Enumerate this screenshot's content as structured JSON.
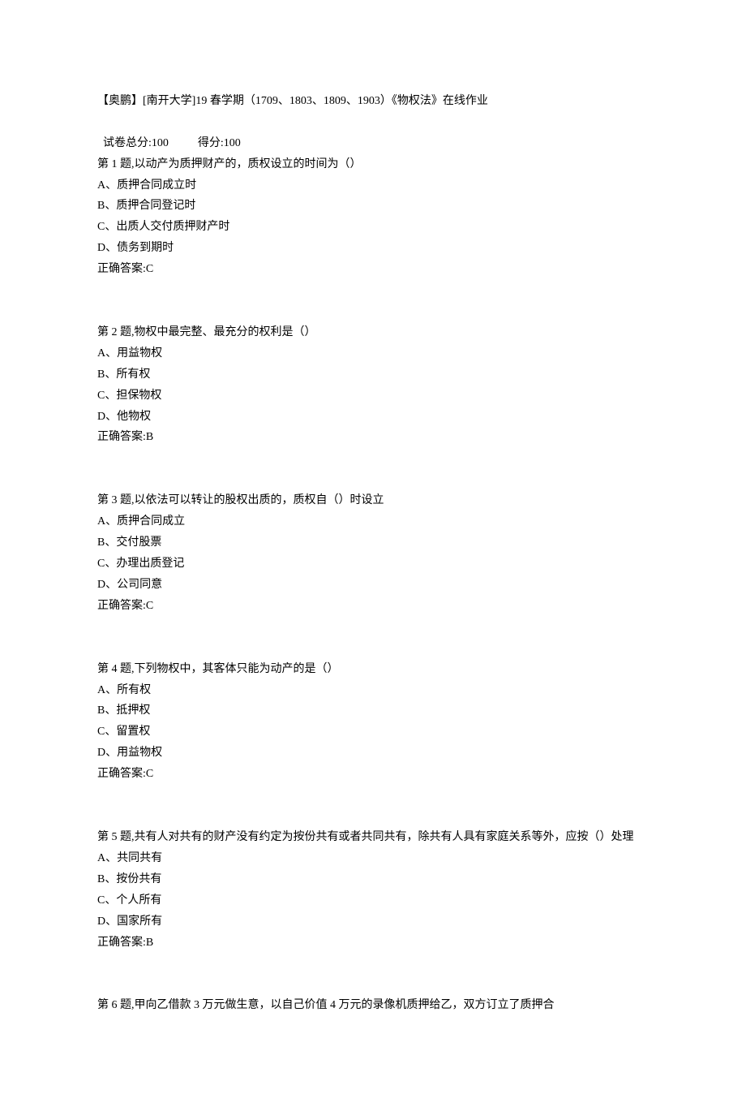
{
  "header": {
    "title": "【奥鹏】[南开大学]19 春学期（1709、1803、1809、1903）《物权法》在线作业",
    "score_total_label": "试卷总分:100",
    "score_obtained_label": "得分:100"
  },
  "questions": [
    {
      "stem": "第 1 题,以动产为质押财产的，质权设立的时间为（）",
      "options": [
        "A、质押合同成立时",
        "B、质押合同登记时",
        "C、出质人交付质押财产时",
        "D、债务到期时"
      ],
      "answer": "正确答案:C"
    },
    {
      "stem": "第 2 题,物权中最完整、最充分的权利是（）",
      "options": [
        "A、用益物权",
        "B、所有权",
        "C、担保物权",
        "D、他物权"
      ],
      "answer": "正确答案:B"
    },
    {
      "stem": "第 3 题,以依法可以转让的股权出质的，质权自（）时设立",
      "options": [
        "A、质押合同成立",
        "B、交付股票",
        "C、办理出质登记",
        "D、公司同意"
      ],
      "answer": "正确答案:C"
    },
    {
      "stem": "第 4 题,下列物权中，其客体只能为动产的是（）",
      "options": [
        "A、所有权",
        "B、抵押权",
        "C、留置权",
        "D、用益物权"
      ],
      "answer": "正确答案:C"
    },
    {
      "stem": "第 5 题,共有人对共有的财产没有约定为按份共有或者共同共有，除共有人具有家庭关系等外，应按（）处理",
      "options": [
        "A、共同共有",
        "B、按份共有",
        "C、个人所有",
        "D、国家所有"
      ],
      "answer": "正确答案:B"
    },
    {
      "stem": "第 6 题,甲向乙借款 3 万元做生意，以自己价值 4 万元的录像机质押给乙，双方订立了质押合",
      "options": [],
      "answer": ""
    }
  ]
}
